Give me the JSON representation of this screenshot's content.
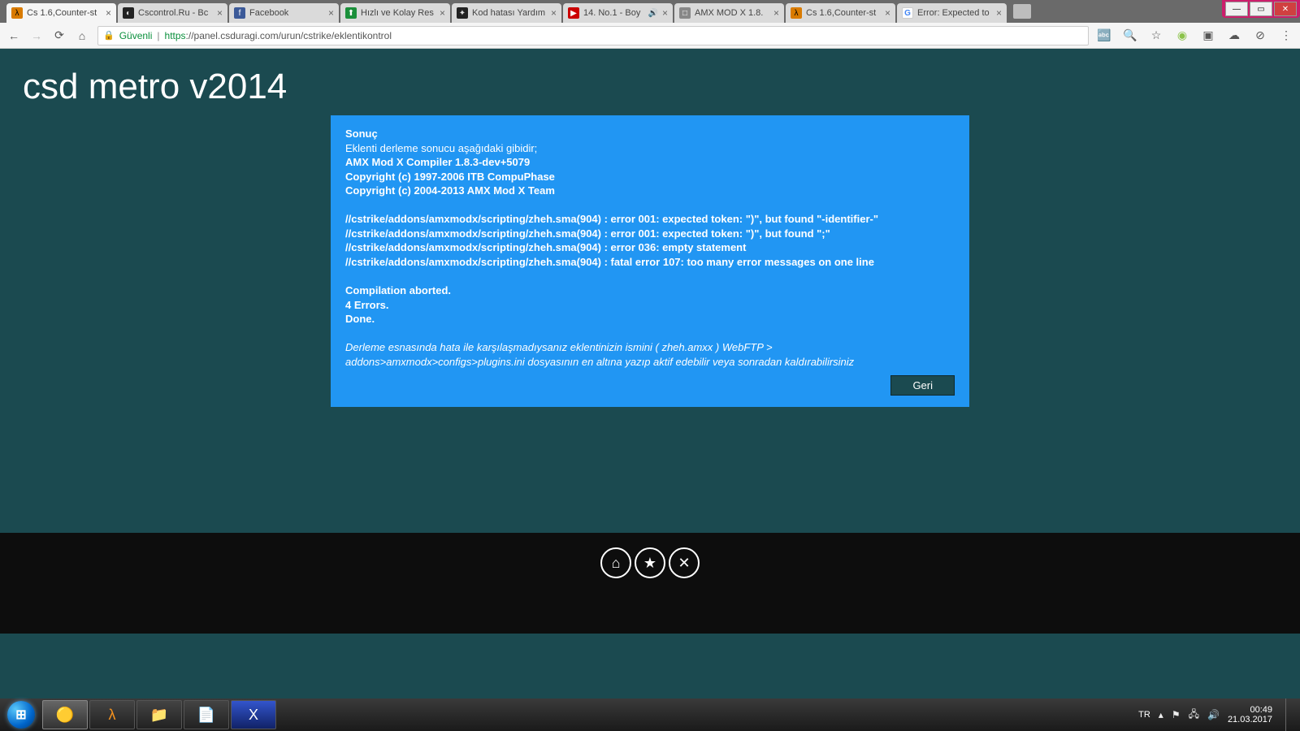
{
  "tabs": [
    {
      "label": "Cs 1.6,Counter-st",
      "fav": "orange",
      "glyph": "λ",
      "active": true
    },
    {
      "label": "Cscontrol.Ru - Bc",
      "fav": "dark",
      "glyph": "◐"
    },
    {
      "label": "Facebook",
      "fav": "fb",
      "glyph": "f"
    },
    {
      "label": "Hızlı ve Kolay Res",
      "fav": "green",
      "glyph": "⬆"
    },
    {
      "label": "Kod hatası Yardım",
      "fav": "dark",
      "glyph": "✦"
    },
    {
      "label": "14. No.1 - Boy",
      "fav": "yt",
      "glyph": "▶",
      "audio": true
    },
    {
      "label": "AMX MOD X 1.8.",
      "fav": "generic",
      "glyph": "□"
    },
    {
      "label": "Cs 1.6,Counter-st",
      "fav": "orange",
      "glyph": "λ"
    },
    {
      "label": "Error: Expected to",
      "fav": "g",
      "glyph": "G"
    }
  ],
  "address": {
    "secure": "Güvenli",
    "https": "https",
    "rest": "://panel.csduragi.com/urun/cstrike/eklentikontrol"
  },
  "page": {
    "title": "csd metro v2014",
    "result_label": "Sonuç",
    "intro": "Eklenti derleme sonucu aşağıdaki gibidir;",
    "compiler_line": "AMX Mod X Compiler 1.8.3-dev+5079",
    "copyright1": "Copyright (c) 1997-2006 ITB CompuPhase",
    "copyright2": "Copyright (c) 2004-2013 AMX Mod X Team",
    "err1": "//cstrike/addons/amxmodx/scripting/zheh.sma(904) : error 001: expected token: \")\", but found \"-identifier-\"",
    "err2": "//cstrike/addons/amxmodx/scripting/zheh.sma(904) : error 001: expected token: \")\", but found \";\"",
    "err3": "//cstrike/addons/amxmodx/scripting/zheh.sma(904) : error 036: empty statement",
    "err4": "//cstrike/addons/amxmodx/scripting/zheh.sma(904) : fatal error 107: too many error messages on one line",
    "aborted": "Compilation aborted.",
    "errcount": "4 Errors.",
    "done": "Done.",
    "footnote": "Derleme esnasında hata ile karşılaşmadıysanız eklentinizin ismini ( zheh.amxx ) WebFTP > addons>amxmodx>configs>plugins.ini dosyasının en altına yazıp aktif edebilir veya sonradan kaldırabilirsiniz",
    "back_btn": "Geri"
  },
  "taskbar": {
    "lang": "TR",
    "time": "00:49",
    "date": "21.03.2017"
  }
}
